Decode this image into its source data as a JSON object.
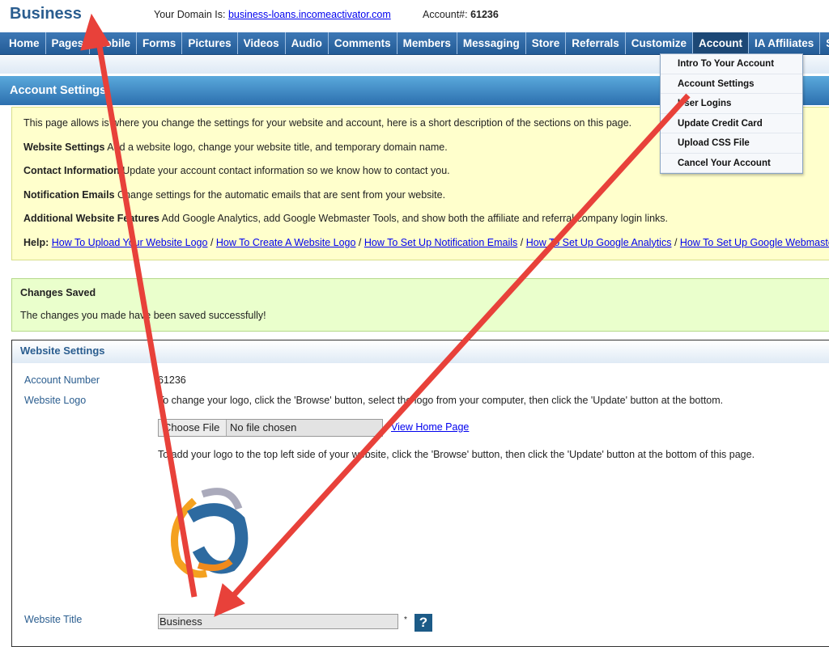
{
  "header": {
    "brand": "Business",
    "domain_label": "Your Domain Is:",
    "domain_link": "business-loans.incomeactivator.com",
    "account_label": "Account#:",
    "account_number": "61236"
  },
  "nav": {
    "items": [
      "Home",
      "Pages",
      "Mobile",
      "Forms",
      "Pictures",
      "Videos",
      "Audio",
      "Comments",
      "Members",
      "Messaging",
      "Store",
      "Referrals",
      "Customize",
      "Account",
      "IA Affiliates",
      "Social"
    ],
    "active": "Account"
  },
  "dropdown": {
    "items": [
      "Intro To Your Account",
      "Account Settings",
      "User Logins",
      "Update Credit Card",
      "Upload CSS File",
      "Cancel Your Account"
    ]
  },
  "page_title": "Account Settings",
  "info": {
    "intro": "This page allows is where you change the settings for your website and account, here is a short description of the sections on this page.",
    "sections": [
      {
        "title": "Website Settings",
        "text": "Add a website logo, change your website title, and temporary domain name."
      },
      {
        "title": "Contact Information",
        "text": "Update your account contact information so we know how to contact you."
      },
      {
        "title": "Notification Emails",
        "text": "Change settings for the automatic emails that are sent from your website."
      },
      {
        "title": "Additional Website Features",
        "text": "Add Google Analytics, add Google Webmaster Tools, and show both the affiliate and referral company login links."
      }
    ],
    "help_label": "Help:",
    "help_links": [
      "How To Upload Your Website Logo",
      "How To Create A Website Logo",
      "How To Set Up Notification Emails",
      "How To Set Up Google Analytics",
      "How To Set Up Google Webmaster Tools"
    ]
  },
  "saved": {
    "title": "Changes Saved",
    "message": "The changes you made have been saved successfully!"
  },
  "website_settings": {
    "title": "Website Settings",
    "account_number_label": "Account Number",
    "account_number": "61236",
    "logo_label": "Website Logo",
    "logo_help": "To change your logo, click the 'Browse' button, select the logo from your computer, then click the 'Update' button at the bottom.",
    "choose_file": "Choose File",
    "no_file": "No file chosen",
    "view_home": "View Home Page",
    "logo_help2": "To add your logo to the top left side of your website, click the 'Browse' button, then click the 'Update' button at the bottom of this page.",
    "title_label": "Website Title",
    "title_value": "Business",
    "required": "*",
    "help_button": "?"
  },
  "colors": {
    "nav": "#235b96",
    "brand": "#2a5d8f",
    "info_bg": "#ffffcc",
    "saved_bg": "#eaffcc",
    "arrow": "#e8413a"
  }
}
